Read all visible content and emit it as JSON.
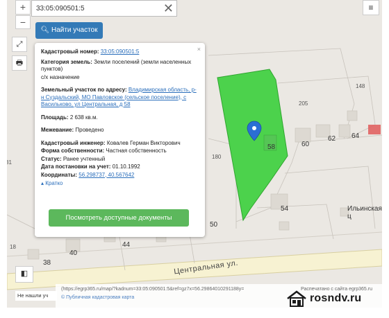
{
  "search": {
    "value": "33:05:090501:5",
    "clear_icon": "close-icon"
  },
  "buttons": {
    "zoom_in": "+",
    "zoom_out": "−",
    "find": "Найти участок",
    "menu_icon": "hamburger-icon",
    "expand_icon": "expand-icon",
    "print_icon": "print-icon",
    "layers_icon": "layers-icon"
  },
  "popup": {
    "close": "×",
    "cadastral_label": "Кадастровый номер:",
    "cadastral_value": "33:05:090501:5",
    "category_label": "Категория земель:",
    "category_value": "Земли поселений (земли населенных пунктов)",
    "usage": "с/х назначение",
    "address_label": "Земельный участок по адресу:",
    "address_value": "Владимирская область, р-н Суздальский, МО Павловское (сельское поселение), с Васильково, ул Центральная, д 58",
    "area_label": "Площадь:",
    "area_value": "2 638 кв.м.",
    "survey_label": "Межевание:",
    "survey_value": "Проведено",
    "engineer_label": "Кадастровый инженер:",
    "engineer_value": "Ковалев Герман Викторович",
    "ownership_label": "Форма собственности:",
    "ownership_value": "Частная собственность",
    "status_label": "Статус:",
    "status_value": "Ранее учтенный",
    "date_label": "Дата постановки на учет:",
    "date_value": "01.10.1992",
    "coords_label": "Координаты:",
    "coords_value": "56.298737, 40.567642",
    "brief": "Кратко",
    "docs_button": "Посмотреть доступные документы"
  },
  "map_labels": {
    "n31": "31",
    "n205": "205",
    "n148": "148",
    "n60": "60",
    "n62": "62",
    "n64": "64",
    "n58": "58",
    "n180": "180",
    "n54": "54",
    "n50": "50",
    "n40": "40",
    "n44": "44",
    "n38": "38",
    "n18": "18",
    "church": "Ильинская ц",
    "street": "Центральная ул."
  },
  "attribution": {
    "url": "(https://egrp365.ru/map/?kadnum=33:05:090501:5&ref=gz7x=56.29864010291188y=",
    "right": "Распечатано с сайта egrp365.ru",
    "pkk": "© Публичная кадастровая карта"
  },
  "not_found": "Не нашли уч",
  "brand": {
    "name": "rosndv.ru",
    "icon": "house-logo-icon"
  },
  "colors": {
    "parcel": "#4cd24c",
    "marker": "#2b6fd4",
    "find_button": "#337ab7",
    "docs_button": "#5cb85c"
  }
}
